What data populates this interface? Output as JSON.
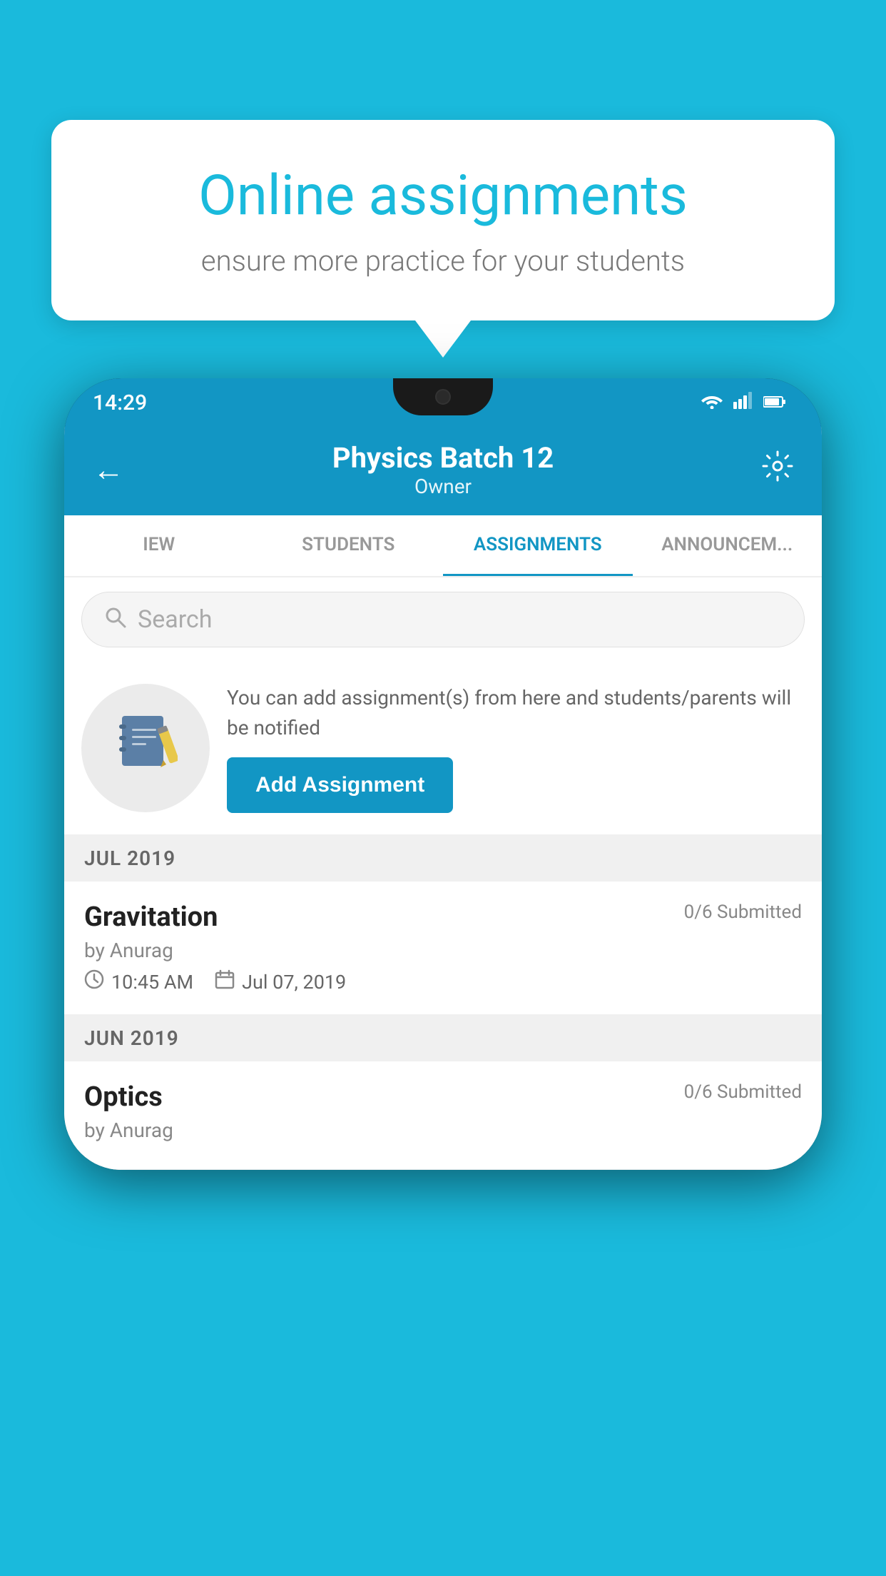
{
  "background_color": "#1ABADC",
  "speech_bubble": {
    "title": "Online assignments",
    "subtitle": "ensure more practice for your students"
  },
  "phone": {
    "status_bar": {
      "time": "14:29",
      "icons": [
        "wifi",
        "signal",
        "battery"
      ]
    },
    "header": {
      "title": "Physics Batch 12",
      "subtitle": "Owner",
      "back_label": "←",
      "settings_label": "⚙"
    },
    "tabs": [
      {
        "label": "IEW",
        "active": false
      },
      {
        "label": "STUDENTS",
        "active": false
      },
      {
        "label": "ASSIGNMENTS",
        "active": true
      },
      {
        "label": "ANNOUNCEM...",
        "active": false
      }
    ],
    "search": {
      "placeholder": "Search"
    },
    "promo": {
      "text": "You can add assignment(s) from here and students/parents will be notified",
      "button_label": "Add Assignment"
    },
    "assignments": [
      {
        "month_label": "JUL 2019",
        "items": [
          {
            "title": "Gravitation",
            "submitted": "0/6 Submitted",
            "by": "by Anurag",
            "time": "10:45 AM",
            "date": "Jul 07, 2019"
          }
        ]
      },
      {
        "month_label": "JUN 2019",
        "items": [
          {
            "title": "Optics",
            "submitted": "0/6 Submitted",
            "by": "by Anurag",
            "time": "",
            "date": ""
          }
        ]
      }
    ]
  }
}
